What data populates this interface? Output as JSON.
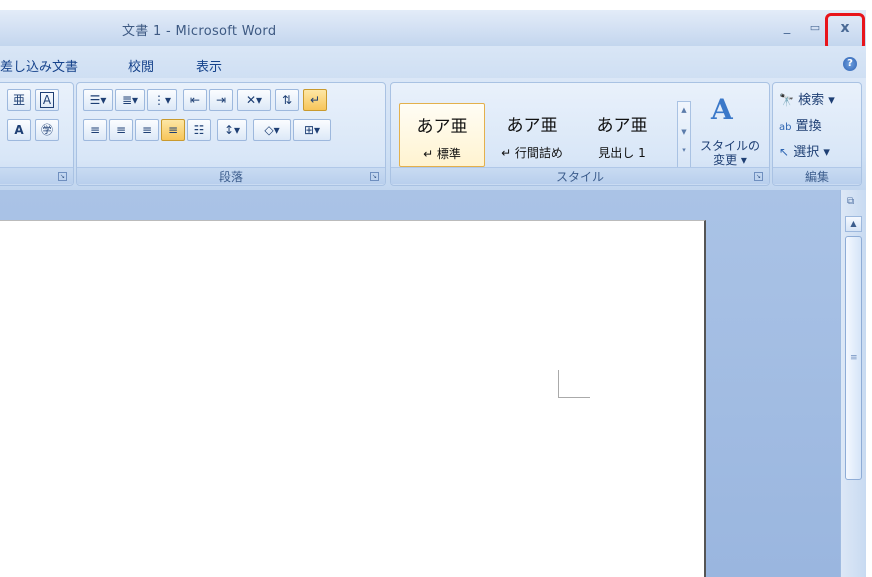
{
  "window": {
    "title": "文書 1 - Microsoft Word",
    "minimize_label": "_",
    "maximize_label": "▭",
    "close_label": "x"
  },
  "tabs": [
    {
      "label": "差し込み文書"
    },
    {
      "label": "校閲"
    },
    {
      "label": "表示"
    }
  ],
  "ribbon": {
    "paragraph_group_label": "段落",
    "style_group_label": "スタイル",
    "edit_group_label": "編集",
    "styles": [
      {
        "sample": "あア亜",
        "name": "↵ 標準"
      },
      {
        "sample": "あア亜",
        "name": "↵ 行間詰め"
      },
      {
        "sample": "あア亜",
        "name": "見出し 1"
      }
    ],
    "change_styles_label_1": "スタイルの",
    "change_styles_label_2": "変更 ▾",
    "edit_items": [
      {
        "label": "検索 ▾"
      },
      {
        "label": "置換"
      },
      {
        "label": "選択 ▾"
      }
    ]
  },
  "colors": {
    "close_highlight": "#e8141b",
    "ribbon_text": "#15428b",
    "document_background": "#9ab6df"
  }
}
